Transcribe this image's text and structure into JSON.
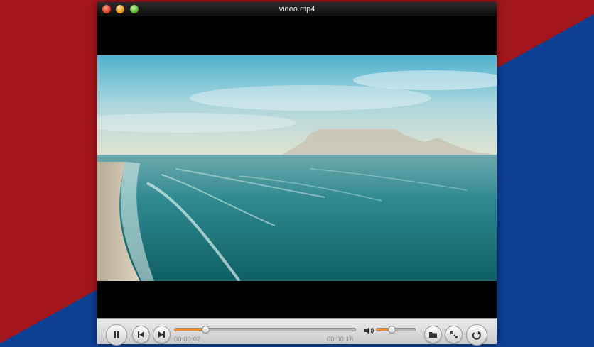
{
  "window": {
    "title": "video.mp4"
  },
  "player": {
    "current_time": "00:00:02",
    "duration": "00:00:18",
    "progress": 0.17,
    "volume": 0.38,
    "state": "playing"
  },
  "controls": {
    "play_pause_icon": "pause-icon",
    "prev_icon": "skip-back-icon",
    "next_icon": "skip-forward-icon",
    "volume_icon": "speaker-icon",
    "open_icon": "folder-icon",
    "fullscreen_icon": "expand-arrows-icon",
    "loop_icon": "repeat-icon"
  },
  "colors": {
    "accent": "#f07a12",
    "desktop_red": "#a3171c",
    "desktop_blue": "#0d3f93"
  }
}
